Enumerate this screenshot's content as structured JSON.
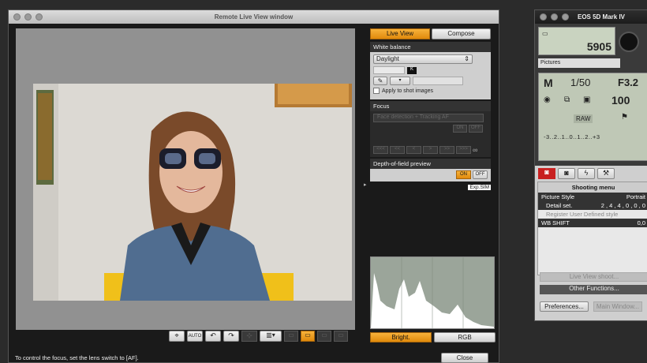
{
  "liveview": {
    "title": "Remote Live View window",
    "tab_live": "Live View",
    "tab_compose": "Compose",
    "wb_title": "White balance",
    "wb_value": "Daylight",
    "wb_k": "K",
    "apply_shot": "Apply to shot images",
    "focus_title": "Focus",
    "focus_mode": "Face detection + Tracking AF",
    "on": "ON",
    "off": "OFF",
    "focus_buttons": [
      "<<<",
      "<<",
      "<",
      ">",
      ">>",
      ">>>"
    ],
    "focus_inf": "∞",
    "dof_title": "Depth-of-field preview",
    "dof_on": "ON",
    "dof_off": "OFF",
    "expsim": "Exp.SIM",
    "hist_bright": "Bright.",
    "hist_rgb": "RGB",
    "status": "To control the focus, set the lens switch to [AF].",
    "close": "Close",
    "toolbar_icons": [
      "crosshair-icon",
      "awb-icon",
      "rotate-left-icon",
      "rotate-right-icon",
      "grid-icon",
      "aspect-icon",
      "zoom-1-icon",
      "zoom-5-icon",
      "zoom-10-icon",
      "zoom-100-icon"
    ]
  },
  "camera": {
    "title": "EOS 5D Mark IV",
    "shots": "5905",
    "folder": "Pictures",
    "shutter": "1/50",
    "aperture": "F3.2",
    "iso": "100",
    "quality": "RAW",
    "scale": "-3..2..1..0..1..2..+3",
    "tabs": [
      "shooting-tab",
      "camera-settings-tab",
      "flash-tab",
      "tools-tab"
    ],
    "menu_title": "Shooting menu",
    "rows": [
      {
        "label": "Picture Style",
        "value": "Portrait"
      },
      {
        "label": "Detail set.",
        "value": "2 , 4 , 4 , 0 , 0 , 0"
      },
      {
        "label": "Register User Defined style",
        "value": ""
      },
      {
        "label": "WB SHIFT",
        "value": "0,0"
      }
    ],
    "live_view_shoot": "Live View shoot...",
    "other_functions": "Other Functions...",
    "preferences": "Preferences...",
    "main_window": "Main Window..."
  },
  "colors": {
    "accent": "#f0a020",
    "panel": "#1a1a1a",
    "lv_bg": "#919191"
  }
}
